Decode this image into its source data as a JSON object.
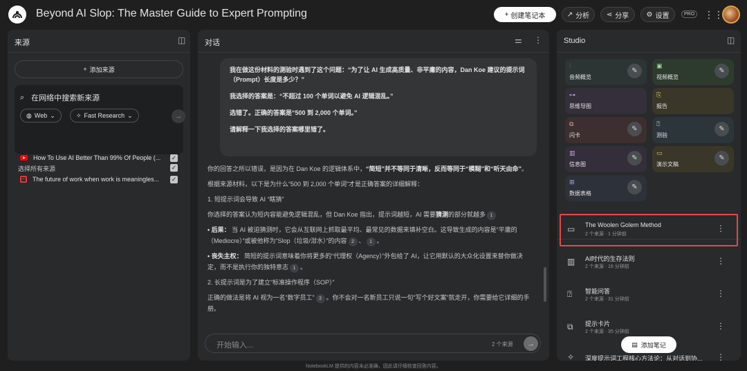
{
  "header": {
    "title": "Beyond AI Slop: The Master Guide to Expert Prompting",
    "create_label": "创建笔记本",
    "analytics_label": "分析",
    "share_label": "分享",
    "settings_label": "设置",
    "pro_badge": "PRO"
  },
  "sources": {
    "title": "来源",
    "add_label": "添加来源",
    "search_text": "在网络中搜索新来源",
    "web_chip": "Web",
    "research_chip": "Fast Research",
    "select_all": "选择所有来源",
    "items": [
      {
        "label": "How To Use AI Better Than 99% Of People (...",
        "icon": "youtube-icon"
      },
      {
        "label": "The future of work when work is meaningles...",
        "icon": "document-icon"
      }
    ]
  },
  "chat": {
    "title": "对话",
    "user_message": [
      "我在做这份材料的测验时遇到了这个问题：“为了让 AI 生成高质量、非平庸的内容，Dan Koe 建议的提示词（Prompt）长度是多少？”",
      "我选择的答案是：“不超过 100 个单词以避免 AI 逻辑混乱。”",
      "选错了。正确的答案是“500 到 2,000 个单词。”",
      "请解释一下我选择的答案哪里错了。"
    ],
    "response": {
      "p1_a": "你的回答之所以错误，是因为在 Dan Koe 的逻辑体系中，",
      "p1_b": "“简短”并不等同于清晰，反而等同于“模糊”和“听天由命”",
      "p1_c": "。",
      "p2": "根据来源材料，以下是为什么“500 到 2,000 个单词”才是正确答案的详细解释：",
      "h1": "1. 短提示词会导致 AI “瞎猜”",
      "p3_a": "你选择的答案认为短内容能避免逻辑混乱，但 Dan Koe 指出，提示词越短，AI 需要",
      "p3_b": "猜测",
      "p3_c": "的部分就越多",
      "b1_label": "• 后果：",
      "b1_text": "当 AI 被迫猜测时，它会从互联网上抓取最平均、最常见的数据来填补空白。这导致生成的内容是“平庸的（Mediocre）”或被他称为“Slop（垃圾/泔水）”的内容",
      "b2_label": "• 丧失主权：",
      "b2_text": "简短的提示词意味着你将更多的“代理权（Agency）”外包给了 AI，让它用默认的大众化设置来替你做决定，而不是执行你的独特意志",
      "h2": "2. 长提示词是为了建立“标准操作程序（SOP）”",
      "p4": "正确的做法是将 AI 视为一名“数字员工”",
      "p4_b": "。你不会对一名新员工只说一句“写个好文案”就走开，你需要给它详细的手册。",
      "cites": [
        "1",
        "2",
        "1",
        "1",
        "3"
      ]
    },
    "input_placeholder": "开始输入...",
    "source_count": "2 个来源"
  },
  "studio": {
    "title": "Studio",
    "tiles": [
      {
        "label": "音频概览",
        "icon": "audio-icon",
        "color": "#2c3533"
      },
      {
        "label": "视频概览",
        "icon": "video-icon",
        "color": "#2d3a2e"
      },
      {
        "label": "思维导图",
        "icon": "mindmap-icon",
        "color": "#352f3b"
      },
      {
        "label": "报告",
        "icon": "report-icon",
        "color": "#3a3729"
      },
      {
        "label": "闪卡",
        "icon": "flashcard-icon",
        "color": "#3d2f2f"
      },
      {
        "label": "测验",
        "icon": "quiz-icon",
        "color": "#2c3539"
      },
      {
        "label": "信息图",
        "icon": "infographic-icon",
        "color": "#342e3a"
      },
      {
        "label": "演示文稿",
        "icon": "slides-icon",
        "color": "#3a3729"
      },
      {
        "label": "数据表格",
        "icon": "table-icon",
        "color": "#2d3139"
      }
    ],
    "notes": [
      {
        "title": "The Woolen Golem Method",
        "meta": "2 个来源 · 1 分钟前",
        "icon": "slides-icon"
      },
      {
        "title": "AI时代的生存法则",
        "meta": "2 个来源 · 16 分钟前",
        "icon": "infographic-icon"
      },
      {
        "title": "智能问答",
        "meta": "2 个来源 · 31 分钟前",
        "icon": "quiz-icon"
      },
      {
        "title": "提示卡片",
        "meta": "2 个来源 · 35 分钟前",
        "icon": "flashcard-icon"
      },
      {
        "title": "深度提示词工程核心方法论：从对话到协...",
        "meta": "",
        "icon": "report-icon"
      }
    ],
    "add_note_label": "添加笔记"
  },
  "footer": "NotebookLM 提供的内容未必准确，因此请仔细核查回答内容。"
}
